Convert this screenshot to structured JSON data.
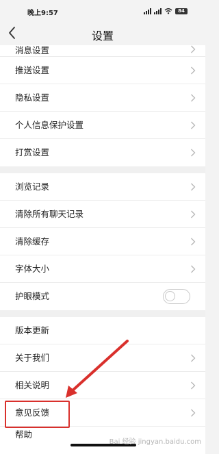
{
  "status_bar": {
    "time": "晚上9:57",
    "battery": "84"
  },
  "header": {
    "title": "设置"
  },
  "groups": [
    {
      "items": [
        {
          "label": "消息设置"
        },
        {
          "label": "推送设置"
        },
        {
          "label": "隐私设置"
        },
        {
          "label": "个人信息保护设置"
        },
        {
          "label": "打赏设置"
        }
      ]
    },
    {
      "items": [
        {
          "label": "浏览记录"
        },
        {
          "label": "清除所有聊天记录"
        },
        {
          "label": "清除缓存"
        },
        {
          "label": "字体大小"
        },
        {
          "label": "护眼模式",
          "toggle": false
        }
      ]
    },
    {
      "items": [
        {
          "label": "版本更新"
        },
        {
          "label": "关于我们"
        },
        {
          "label": "相关说明"
        },
        {
          "label": "意见反馈",
          "highlighted": true
        },
        {
          "label": "帮助"
        }
      ]
    }
  ],
  "watermark": "Bai 经验 jingyan.baidu.com",
  "colors": {
    "highlight": "#d9302c",
    "background": "#f3f3f3"
  }
}
